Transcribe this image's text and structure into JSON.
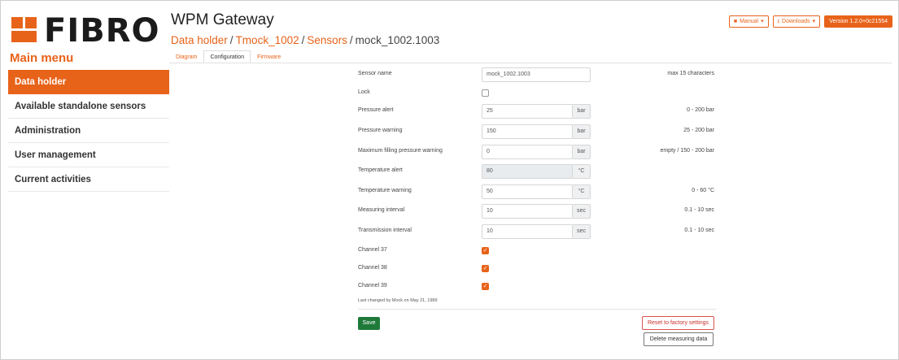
{
  "brand": {
    "name": "FIBRO",
    "accent": "#e8631a"
  },
  "header": {
    "app_title": "WPM Gateway",
    "breadcrumb": {
      "item1": "Data holder",
      "item2": "Tmock_1002",
      "item3": "Sensors",
      "current": "mock_1002.1003",
      "separator": "/"
    },
    "tabs": [
      "Diagram",
      "Configuration",
      "Firmware"
    ]
  },
  "top_buttons": {
    "manual": "Manual",
    "downloads": "Downloads",
    "version": "Version 1.2.0+0c21554"
  },
  "sidebar": {
    "title": "Main menu",
    "items": [
      {
        "label": "Data holder",
        "active": true
      },
      {
        "label": "Available standalone sensors"
      },
      {
        "label": "Administration"
      },
      {
        "label": "User management"
      },
      {
        "label": "Current activities"
      }
    ]
  },
  "form": {
    "sensor_name": {
      "label": "Sensor name",
      "value": "mock_1002.1003",
      "hint": "max 15 characters"
    },
    "lock": {
      "label": "Lock",
      "checked": false
    },
    "pressure_alert": {
      "label": "Pressure alert",
      "value": "25",
      "unit": "bar",
      "hint": "0 - 200 bar"
    },
    "pressure_warning": {
      "label": "Pressure warning",
      "value": "150",
      "unit": "bar",
      "hint": "25 - 200 bar"
    },
    "max_filling_pressure_warning": {
      "label": "Maximum filling pressure warning",
      "value": "0",
      "unit": "bar",
      "hint": "empty / 150 - 200 bar"
    },
    "temperature_alert": {
      "label": "Temperature alert",
      "value": "80",
      "unit": "°C"
    },
    "temperature_warning": {
      "label": "Temperature warning",
      "value": "50",
      "unit": "°C",
      "hint": "0 - 60 °C"
    },
    "measuring_interval": {
      "label": "Measuring interval",
      "value": "10",
      "unit": "sec",
      "hint": "0.1 - 10 sec"
    },
    "transmission_interval": {
      "label": "Transmission interval",
      "value": "10",
      "unit": "sec",
      "hint": "0.1 - 10 sec"
    },
    "channel_37": {
      "label": "Channel 37",
      "checked": true
    },
    "channel_38": {
      "label": "Channel 38",
      "checked": true
    },
    "channel_39": {
      "label": "Channel 39",
      "checked": true
    },
    "last_changed": "Last changed by Mock on May 21, 1989",
    "save_label": "Save",
    "reset_label": "Reset to factory settings",
    "delete_label": "Delete measuring data"
  }
}
